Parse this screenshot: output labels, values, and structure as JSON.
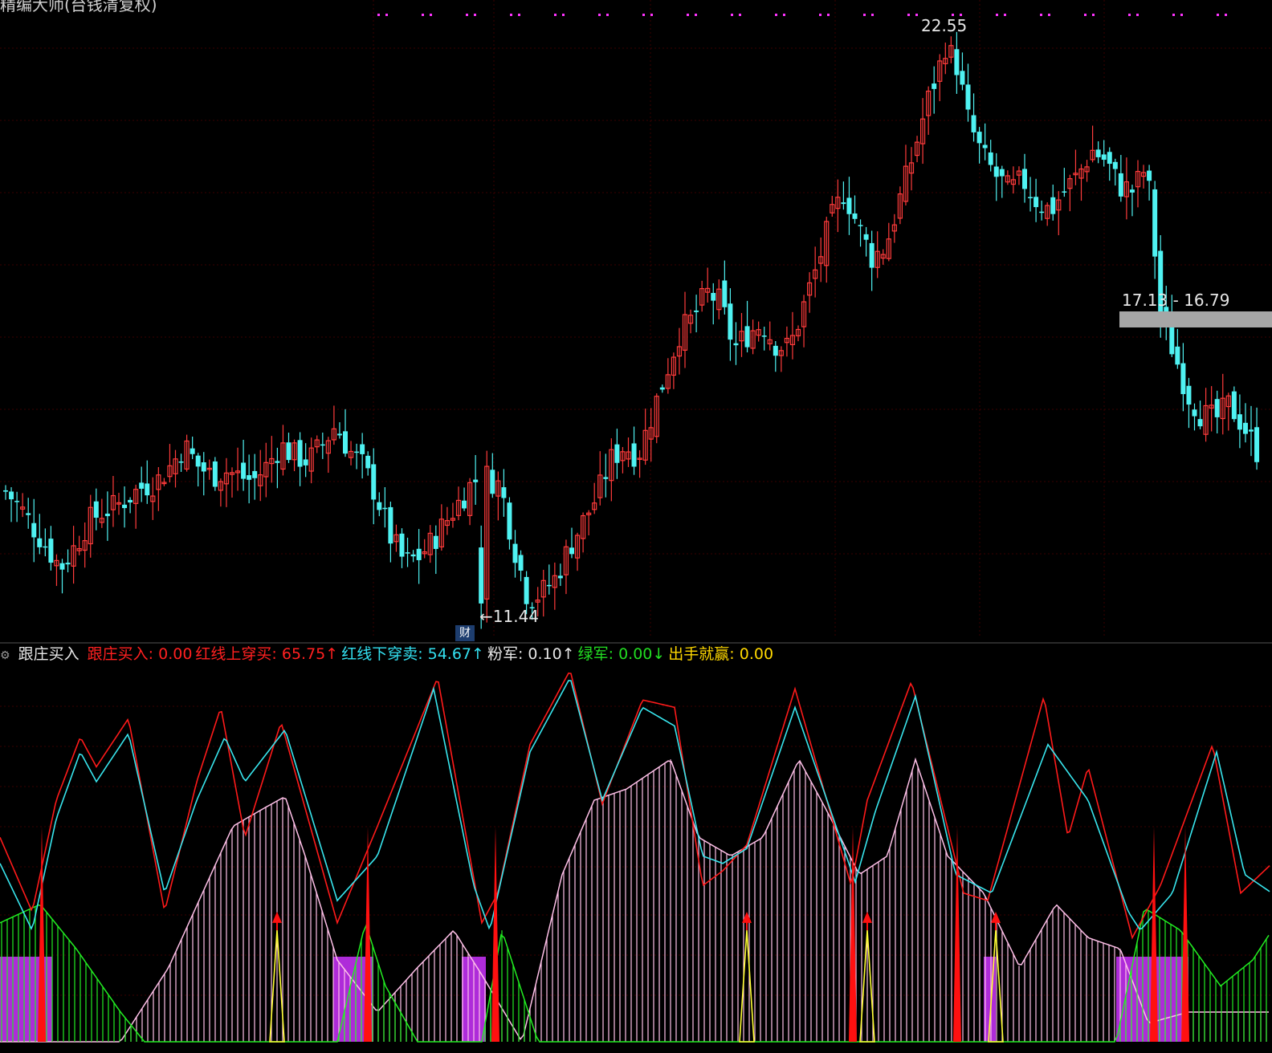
{
  "window": {
    "title_fragment": "精编大师(台钱清复权)",
    "ind_name": "跟庄买入"
  },
  "indicator_header": [
    {
      "label": "跟庄买入:",
      "value": "0.00",
      "arrow": "",
      "color": "#ff2020"
    },
    {
      "label": "红线上穿买:",
      "value": "65.75",
      "arrow": "↑",
      "color": "#ff2020"
    },
    {
      "label": "红线下穿卖:",
      "value": "54.67",
      "arrow": "↑",
      "color": "#33e0f0"
    },
    {
      "label": "粉军:",
      "value": "0.10",
      "arrow": "↑",
      "color": "#e6e6e6"
    },
    {
      "label": "绿军:",
      "value": "0.00",
      "arrow": "↓",
      "color": "#22dd22"
    },
    {
      "label": "出手就赢:",
      "value": "0.00",
      "arrow": "",
      "color": "#ffd800"
    }
  ],
  "annotations": {
    "high_label": "22.55",
    "low_label": "←11.44",
    "band_label": "17.13 - 16.79",
    "cai_badge": "财"
  },
  "colors": {
    "up": "#ff3b3b",
    "down": "#4ff2f2",
    "red_line": "#ff1a1a",
    "cyan_line": "#38e6ee",
    "pink": "#ffc0e8",
    "green": "#22ee22",
    "magenta": "#cc33ff",
    "yellow": "#ffff33",
    "grid": "#3a0000"
  },
  "chart_data": [
    {
      "type": "candlestick",
      "title": "",
      "y_range": [
        10.9,
        23.0
      ],
      "high": 22.55,
      "low": 11.44,
      "band": [
        16.79,
        17.13
      ],
      "close_path": [
        13.7,
        13.4,
        13.0,
        12.6,
        12.2,
        12.6,
        13.1,
        13.3,
        13.4,
        13.6,
        13.8,
        13.9,
        14.2,
        14.6,
        14.2,
        14.0,
        14.1,
        14.0,
        13.9,
        14.2,
        14.6,
        14.4,
        14.3,
        14.6,
        15.0,
        14.5,
        14.2,
        13.6,
        12.8,
        12.3,
        12.4,
        12.7,
        13.1,
        13.5,
        13.9,
        14.0,
        13.8,
        12.6,
        11.6,
        11.7,
        12.0,
        12.6,
        13.1,
        13.6,
        14.3,
        14.6,
        14.4,
        15.2,
        16.0,
        16.8,
        17.1,
        17.6,
        17.4,
        16.5,
        16.8,
        17.0,
        16.6,
        16.5,
        17.3,
        18.1,
        19.0,
        19.6,
        18.9,
        18.3,
        18.5,
        19.4,
        20.3,
        21.3,
        22.1,
        22.3,
        21.0,
        20.3,
        19.9,
        19.6,
        19.8,
        19.4,
        19.2,
        19.6,
        19.9,
        20.4,
        20.2,
        19.7,
        19.6,
        20.1,
        17.2,
        16.4,
        15.6,
        15.2,
        15.1,
        15.4,
        15.0,
        14.5
      ],
      "candle_count": 222
    },
    {
      "type": "line",
      "title": "跟庄买入",
      "y_range": [
        0,
        100
      ],
      "series": [
        {
          "name": "红线上穿买",
          "value": 65.75
        },
        {
          "name": "红线下穿卖",
          "value": 54.67
        },
        {
          "name": "粉军",
          "value": 0.1
        },
        {
          "name": "绿军",
          "value": 0.0
        },
        {
          "name": "出手就赢",
          "value": 0.0
        }
      ]
    }
  ]
}
